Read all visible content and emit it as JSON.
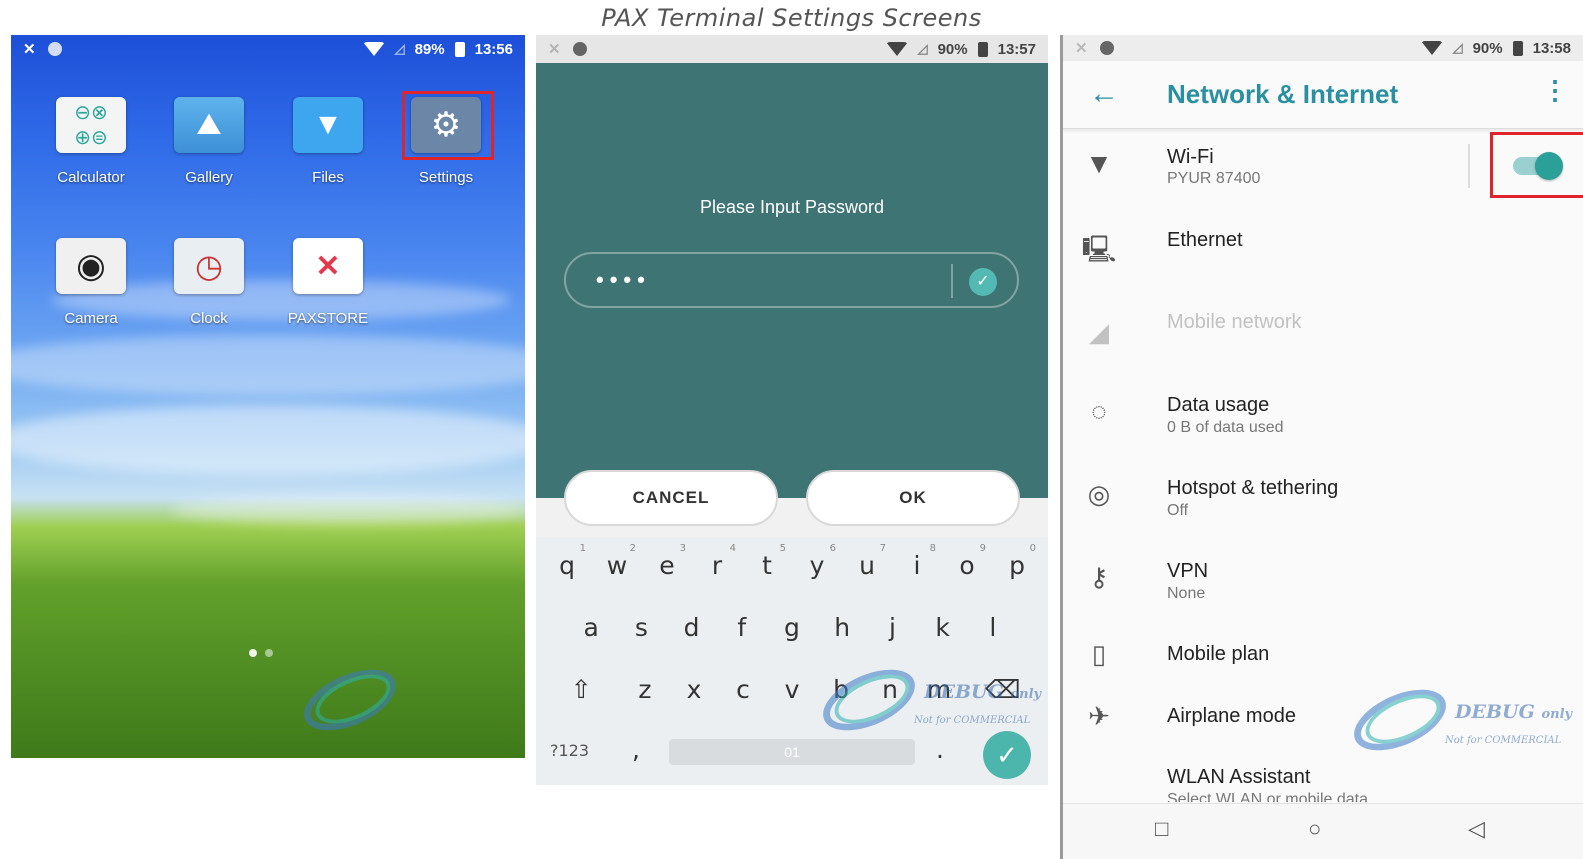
{
  "caption": "PAX Terminal Settings Screens",
  "screen1": {
    "status": {
      "battery": "89%",
      "time": "13:56"
    },
    "apps": [
      {
        "label": "Calculator",
        "icon": "calculator-icon"
      },
      {
        "label": "Gallery",
        "icon": "gallery-icon"
      },
      {
        "label": "Files",
        "icon": "files-icon"
      },
      {
        "label": "Settings",
        "icon": "gear-icon"
      },
      {
        "label": "Camera",
        "icon": "camera-icon"
      },
      {
        "label": "Clock",
        "icon": "clock-icon"
      },
      {
        "label": "PAXSTORE",
        "icon": "paxstore-icon"
      }
    ],
    "highlight_color": "#e0242c"
  },
  "screen2": {
    "status": {
      "battery": "90%",
      "time": "13:57"
    },
    "title": "Please Input Password",
    "password_mask": "••••",
    "cancel": "CANCEL",
    "ok": "OK",
    "keyboard": {
      "row1": [
        "q",
        "w",
        "e",
        "r",
        "t",
        "y",
        "u",
        "i",
        "o",
        "p"
      ],
      "row1_hints": [
        "1",
        "2",
        "3",
        "4",
        "5",
        "6",
        "7",
        "8",
        "9",
        "0"
      ],
      "row2": [
        "a",
        "s",
        "d",
        "f",
        "g",
        "h",
        "j",
        "k",
        "l"
      ],
      "row3": [
        "z",
        "x",
        "c",
        "v",
        "b",
        "n",
        "m"
      ],
      "symbols": "?123",
      "comma": ",",
      "period": ".",
      "space_hint": "01"
    },
    "accent": "#3f7474"
  },
  "screen3": {
    "status": {
      "battery": "90%",
      "time": "13:58"
    },
    "title": "Network & Internet",
    "items": [
      {
        "title": "Wi-Fi",
        "sub": "PYUR 87400",
        "icon": "wifi-icon"
      },
      {
        "title": "Ethernet",
        "sub": "",
        "icon": "ethernet-icon"
      },
      {
        "title": "Mobile network",
        "sub": "",
        "icon": "cell-signal-icon"
      },
      {
        "title": "Data usage",
        "sub": "0 B of data used",
        "icon": "data-usage-icon"
      },
      {
        "title": "Hotspot & tethering",
        "sub": "Off",
        "icon": "hotspot-icon"
      },
      {
        "title": "VPN",
        "sub": "None",
        "icon": "vpn-key-icon"
      },
      {
        "title": "Mobile plan",
        "sub": "",
        "icon": "phone-icon"
      },
      {
        "title": "Airplane mode",
        "sub": "",
        "icon": "airplane-icon"
      },
      {
        "title": "WLAN Assistant",
        "sub": "Select WLAN or mobile data",
        "icon": ""
      }
    ],
    "wifi_enabled": true,
    "accent": "#2a8fa0"
  },
  "watermark": {
    "text": "DEBUG",
    "text_small": "only",
    "subtext": "Not for COMMERCIAL"
  }
}
